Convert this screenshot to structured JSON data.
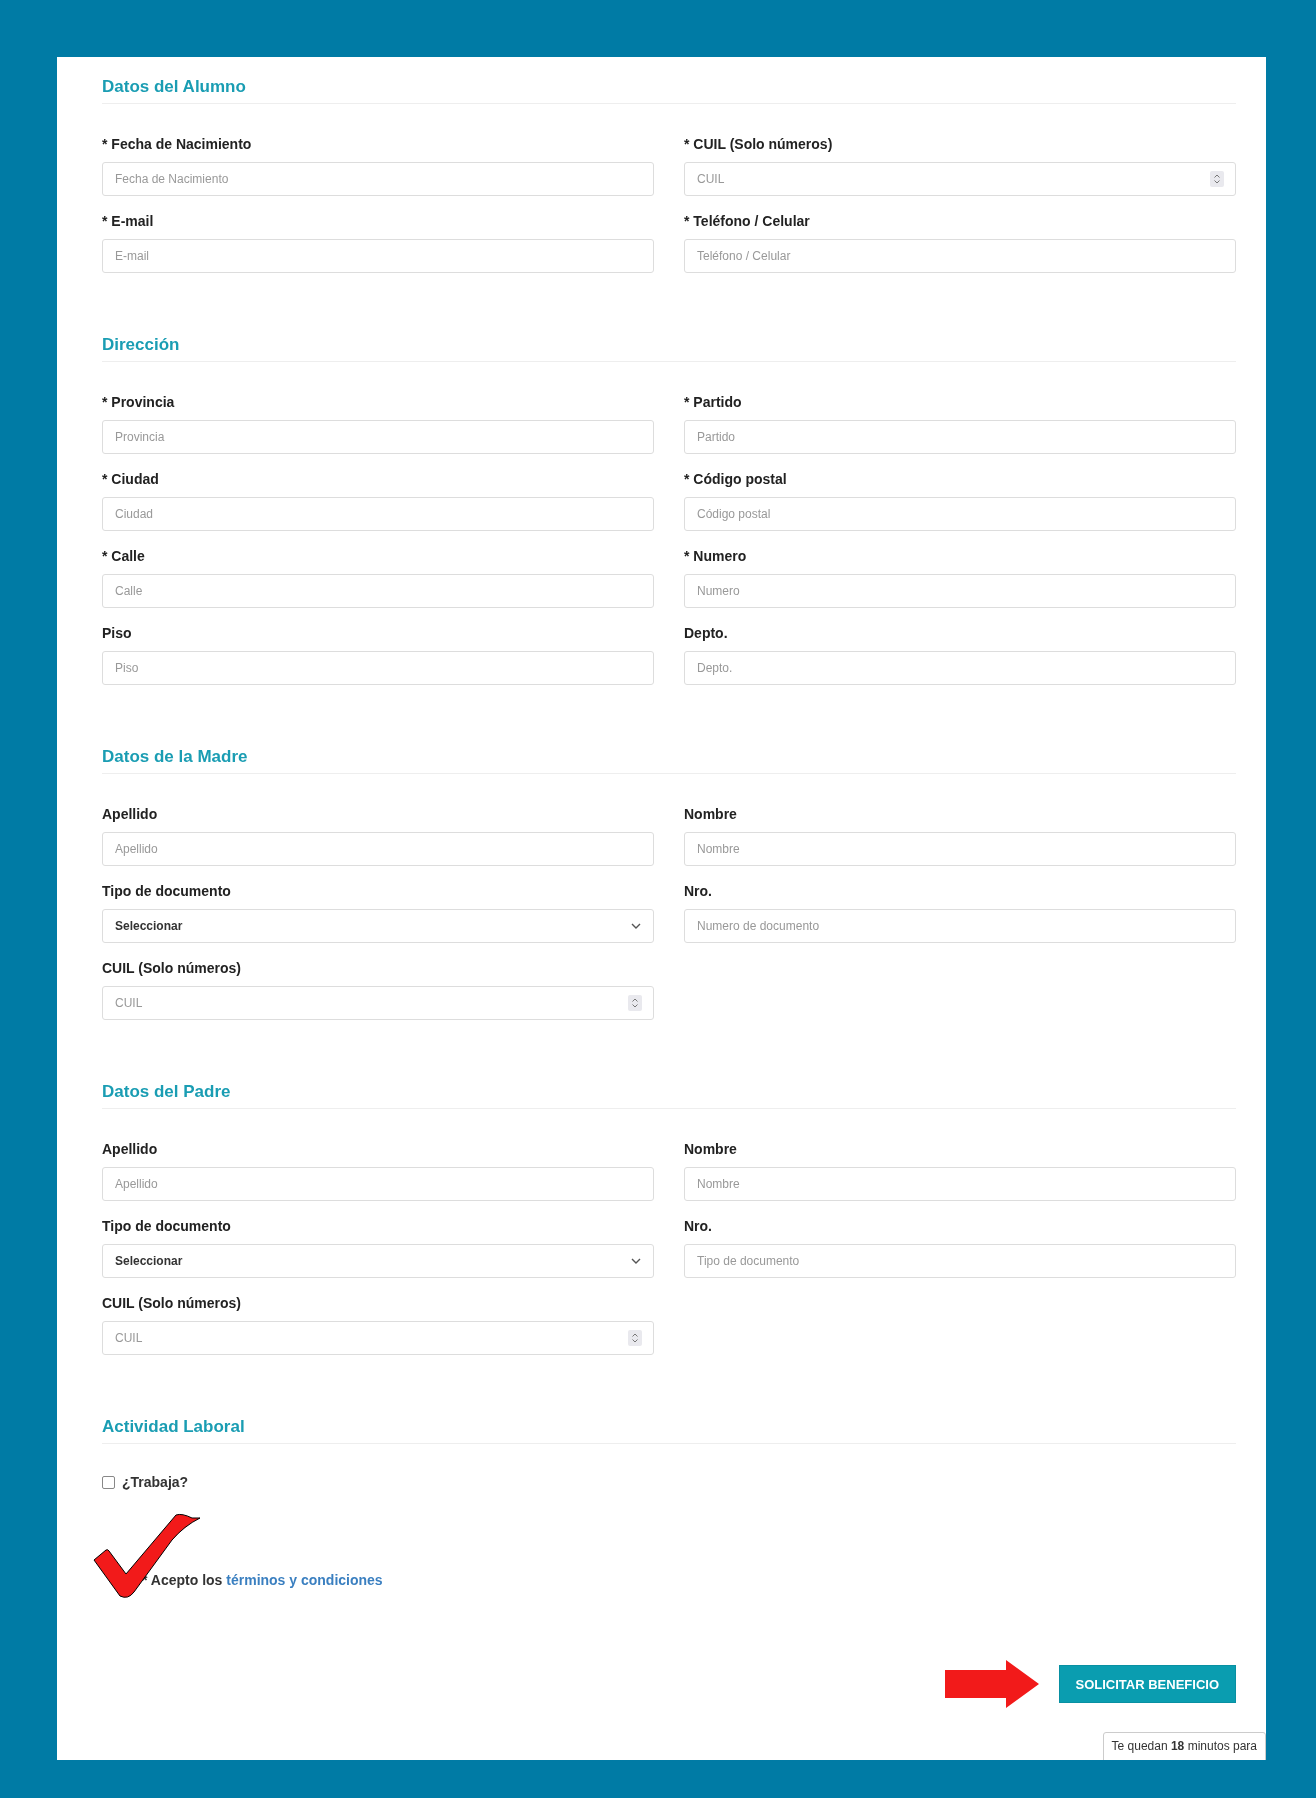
{
  "sections": [
    {
      "title": "Datos del Alumno",
      "fields": [
        {
          "label": "* Fecha de Nacimiento",
          "placeholder": "Fecha de Nacimiento",
          "kind": "text"
        },
        {
          "label": "* CUIL (Solo números)",
          "placeholder": "CUIL",
          "kind": "number"
        },
        {
          "label": "* E-mail",
          "placeholder": "E-mail",
          "kind": "text"
        },
        {
          "label": "* Teléfono / Celular",
          "placeholder": "Teléfono / Celular",
          "kind": "text"
        }
      ]
    },
    {
      "title": "Dirección",
      "fields": [
        {
          "label": "* Provincia",
          "placeholder": "Provincia",
          "kind": "text"
        },
        {
          "label": "* Partido",
          "placeholder": "Partido",
          "kind": "text"
        },
        {
          "label": "* Ciudad",
          "placeholder": "Ciudad",
          "kind": "text"
        },
        {
          "label": "* Código postal",
          "placeholder": "Código postal",
          "kind": "text"
        },
        {
          "label": "* Calle",
          "placeholder": "Calle",
          "kind": "text"
        },
        {
          "label": "* Numero",
          "placeholder": "Numero",
          "kind": "text"
        },
        {
          "label": "Piso",
          "placeholder": "Piso",
          "kind": "text"
        },
        {
          "label": "Depto.",
          "placeholder": "Depto.",
          "kind": "text"
        }
      ]
    },
    {
      "title": "Datos de la Madre",
      "fields": [
        {
          "label": "Apellido",
          "placeholder": "Apellido",
          "kind": "text"
        },
        {
          "label": "Nombre",
          "placeholder": "Nombre",
          "kind": "text"
        },
        {
          "label": "Tipo de documento",
          "value": "Seleccionar",
          "kind": "select"
        },
        {
          "label": "Nro.",
          "placeholder": "Numero de documento",
          "kind": "text"
        },
        {
          "label": "CUIL (Solo números)",
          "placeholder": "CUIL",
          "kind": "number"
        }
      ]
    },
    {
      "title": "Datos del Padre",
      "fields": [
        {
          "label": "Apellido",
          "placeholder": "Apellido",
          "kind": "text"
        },
        {
          "label": "Nombre",
          "placeholder": "Nombre",
          "kind": "text"
        },
        {
          "label": "Tipo de documento",
          "value": "Seleccionar",
          "kind": "select"
        },
        {
          "label": "Nro.",
          "placeholder": "Tipo de documento",
          "kind": "text"
        },
        {
          "label": "CUIL (Solo números)",
          "placeholder": "CUIL",
          "kind": "number"
        }
      ]
    },
    {
      "title": "Actividad Laboral",
      "checkbox": {
        "label": "¿Trabaja?",
        "checked": false
      }
    }
  ],
  "terms": {
    "text": "* Acepto los",
    "link": "términos y condiciones"
  },
  "submit_button": "SOLICITAR BENEFICIO",
  "timer_notice": "Te quedan **18** minutos para"
}
